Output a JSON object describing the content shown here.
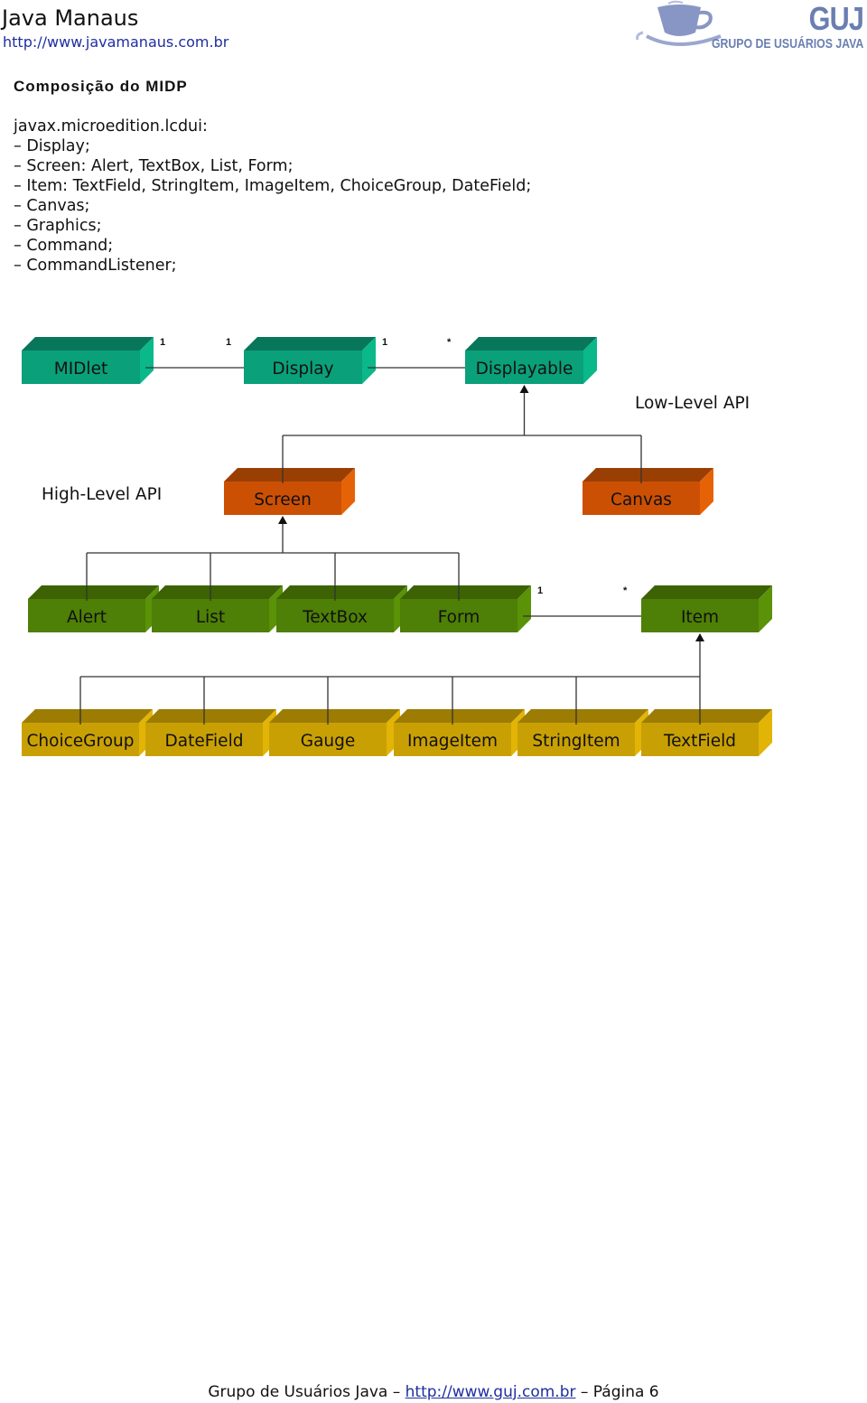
{
  "header": {
    "site_title": "Java Manaus",
    "site_url": "http://www.javamanaus.com.br",
    "logo": {
      "icon": "coffee-cup-icon",
      "title": "GUJ",
      "subtitle": "GRUPO DE USUÁRIOS JAVA"
    }
  },
  "section_title": "Composição do MIDP",
  "content_lines": [
    "javax.microedition.lcdui:",
    "– Display;",
    "– Screen: Alert, TextBox, List, Form;",
    "– Item: TextField, StringItem, ImageItem, ChoiceGroup, DateField;",
    "– Canvas;",
    "– Graphics;",
    "– Command;",
    "– CommandListener;"
  ],
  "diagram": {
    "colors": {
      "teal": {
        "front": "#0aa07a",
        "top": "#08765a",
        "side": "#0ab88a"
      },
      "orange": {
        "front": "#cc5004",
        "top": "#9a3f04",
        "side": "#e66206"
      },
      "green": {
        "front": "#4e7f06",
        "top": "#3c6204",
        "side": "#5a9208"
      },
      "gold": {
        "front": "#c9a004",
        "top": "#9c7c02",
        "side": "#e2b406"
      }
    },
    "labels": {
      "low_level_api": "Low-Level API",
      "high_level_api": "High-Level API"
    },
    "boxes": [
      {
        "id": "midlet",
        "label": "MIDlet",
        "color": "teal"
      },
      {
        "id": "display",
        "label": "Display",
        "color": "teal"
      },
      {
        "id": "displayable",
        "label": "Displayable",
        "color": "teal"
      },
      {
        "id": "screen",
        "label": "Screen",
        "color": "orange"
      },
      {
        "id": "canvas",
        "label": "Canvas",
        "color": "orange"
      },
      {
        "id": "alert",
        "label": "Alert",
        "color": "green"
      },
      {
        "id": "list",
        "label": "List",
        "color": "green"
      },
      {
        "id": "textbox",
        "label": "TextBox",
        "color": "green"
      },
      {
        "id": "form",
        "label": "Form",
        "color": "green"
      },
      {
        "id": "item",
        "label": "Item",
        "color": "green"
      },
      {
        "id": "choicegroup",
        "label": "ChoiceGroup",
        "color": "gold"
      },
      {
        "id": "datefield",
        "label": "DateField",
        "color": "gold"
      },
      {
        "id": "gauge",
        "label": "Gauge",
        "color": "gold"
      },
      {
        "id": "imageitem",
        "label": "ImageItem",
        "color": "gold"
      },
      {
        "id": "stringitem",
        "label": "StringItem",
        "color": "gold"
      },
      {
        "id": "textfield",
        "label": "TextField",
        "color": "gold"
      }
    ],
    "associations": [
      {
        "from": "midlet",
        "to": "display",
        "from_mult": "1",
        "to_mult": "1"
      },
      {
        "from": "display",
        "to": "displayable",
        "from_mult": "1",
        "to_mult": "*"
      },
      {
        "from": "form",
        "to": "item",
        "from_mult": "1",
        "to_mult": "*"
      }
    ],
    "inheritance": [
      {
        "parent": "displayable",
        "children": [
          "screen",
          "canvas"
        ]
      },
      {
        "parent": "screen",
        "children": [
          "alert",
          "list",
          "textbox",
          "form"
        ]
      },
      {
        "parent": "item",
        "children": [
          "choicegroup",
          "datefield",
          "gauge",
          "imageitem",
          "stringitem",
          "textfield"
        ]
      }
    ]
  },
  "footer": {
    "prefix": "Grupo de Usuários Java – ",
    "link": "http://www.guj.com.br",
    "suffix": " – Página 6"
  }
}
